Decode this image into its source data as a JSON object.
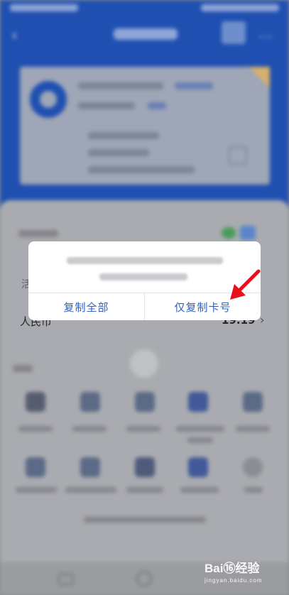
{
  "nav": {
    "back_icon": "back-arrow-icon",
    "more_icon": "more-dots-icon"
  },
  "list": {
    "partial_char": "活",
    "currency_label": "人民币",
    "amount": "19.19",
    "chevron": "›"
  },
  "dialog": {
    "copy_all_label": "复制全部",
    "copy_card_label": "仅复制卡号"
  },
  "watermark": {
    "brand": "Bai⑯经验",
    "sub": "jingyan.baidu.com"
  },
  "colors": {
    "accent": "#2f63c4",
    "header": "#1f4fb0",
    "arrow": "#e8111b"
  }
}
